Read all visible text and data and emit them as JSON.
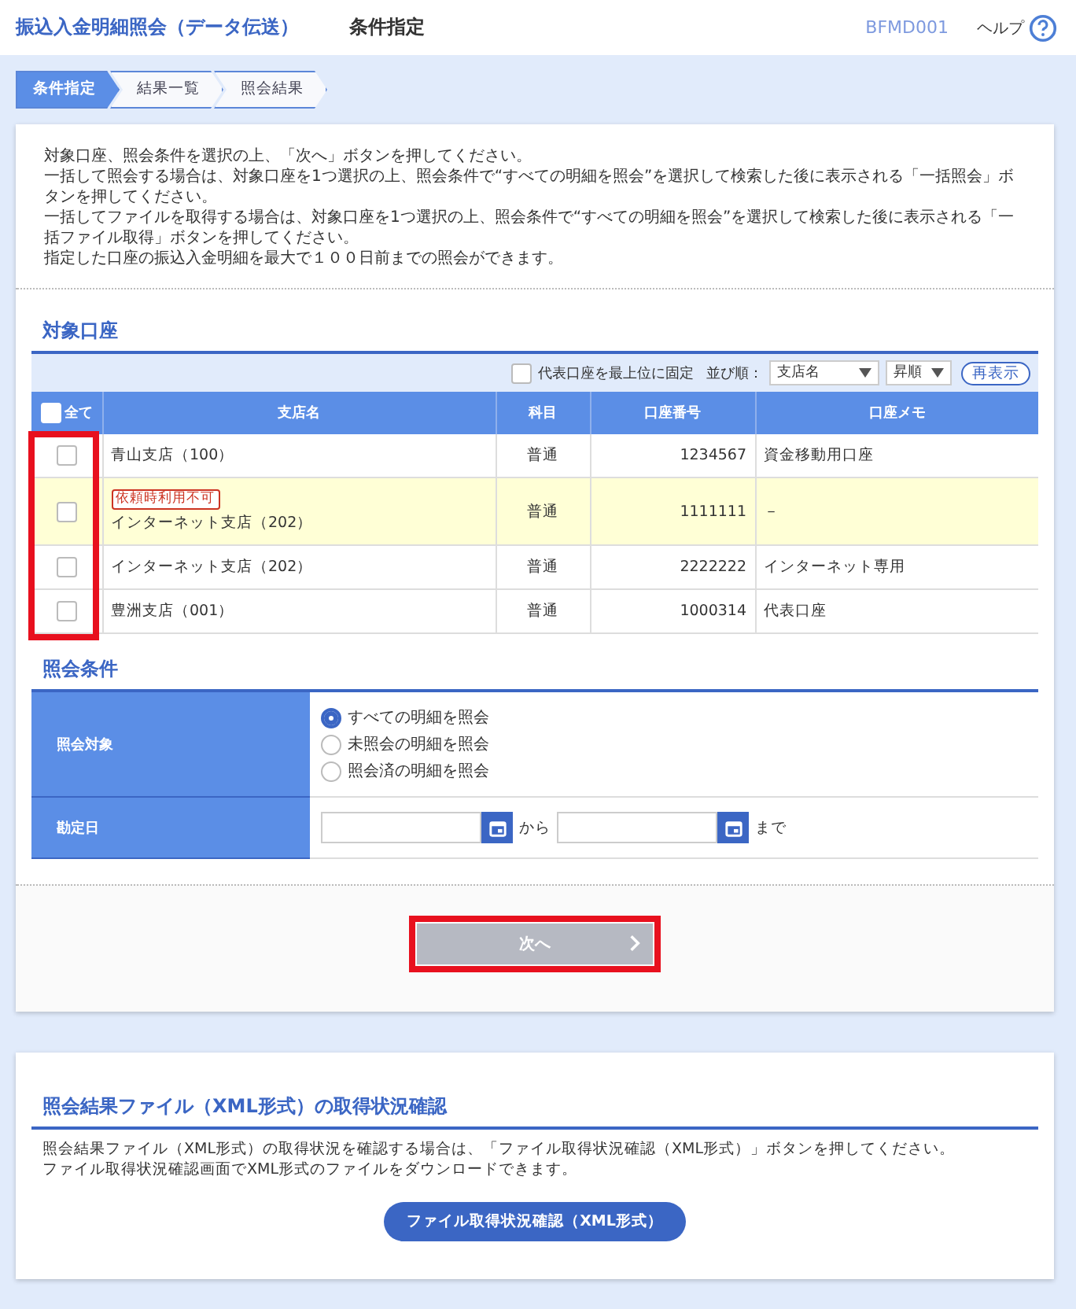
{
  "header": {
    "title": "振込入金明細照会（データ伝送）",
    "subtitle": "条件指定",
    "screen_id": "BFMD001",
    "help": "ヘルプ"
  },
  "steps": [
    {
      "label": "条件指定",
      "selected": true
    },
    {
      "label": "結果一覧",
      "selected": false
    },
    {
      "label": "照会結果",
      "selected": false
    }
  ],
  "instructions": [
    "対象口座、照会条件を選択の上、「次へ」ボタンを押してください。",
    "一括して照会する場合は、対象口座を1つ選択の上、照会条件で“すべての明細を照会”を選択して検索した後に表示される「一括照会」ボタンを押してください。",
    "一括してファイルを取得する場合は、対象口座を1つ選択の上、照会条件で“すべての明細を照会”を選択して検索した後に表示される「一括ファイル取得」ボタンを押してください。",
    "指定した口座の振込入金明細を最大で１００日前までの照会ができます。"
  ],
  "accounts": {
    "heading": "対象口座",
    "pin_label": "代表口座を最上位に固定",
    "pin_checked": false,
    "sort_label": "並び順：",
    "sort_field": "支店名",
    "sort_order": "昇順",
    "refresh": "再表示",
    "select_all": {
      "label": "全て",
      "checked": false
    },
    "checkbox_column_highlighted": true,
    "columns": [
      "支店名",
      "科目",
      "口座番号",
      "口座メモ"
    ],
    "rows": [
      {
        "checked": false,
        "badge": "",
        "branch": "青山支店（100）",
        "type": "普通",
        "number": "1234567",
        "memo": "資金移動用口座",
        "unavailable": false
      },
      {
        "checked": false,
        "badge": "依頼時利用不可",
        "branch": "インターネット支店（202）",
        "type": "普通",
        "number": "1111111",
        "memo": "－",
        "unavailable": true
      },
      {
        "checked": false,
        "badge": "",
        "branch": "インターネット支店（202）",
        "type": "普通",
        "number": "2222222",
        "memo": "インターネット専用",
        "unavailable": false
      },
      {
        "checked": false,
        "badge": "",
        "branch": "豊洲支店（001）",
        "type": "普通",
        "number": "1000314",
        "memo": "代表口座",
        "unavailable": false
      }
    ]
  },
  "conditions": {
    "heading": "照会条件",
    "target_label": "照会対象",
    "options": [
      {
        "label": "すべての明細を照会",
        "selected": true
      },
      {
        "label": "未照会の明細を照会",
        "selected": false
      },
      {
        "label": "照会済の明細を照会",
        "selected": false
      }
    ],
    "date_label": "勘定日",
    "from_text": "から",
    "to_text": "まで"
  },
  "next_button": {
    "label": "次へ",
    "disabled": true,
    "highlighted": true
  },
  "xml_section": {
    "heading": "照会結果ファイル（XML形式）の取得状況確認",
    "text": [
      "照会結果ファイル（XML形式）の取得状況を確認する場合は、「ファイル取得状況確認（XML形式）」ボタンを押してください。",
      "ファイル取得状況確認画面でXML形式のファイルをダウンロードできます。"
    ],
    "button": "ファイル取得状況確認（XML形式）"
  }
}
